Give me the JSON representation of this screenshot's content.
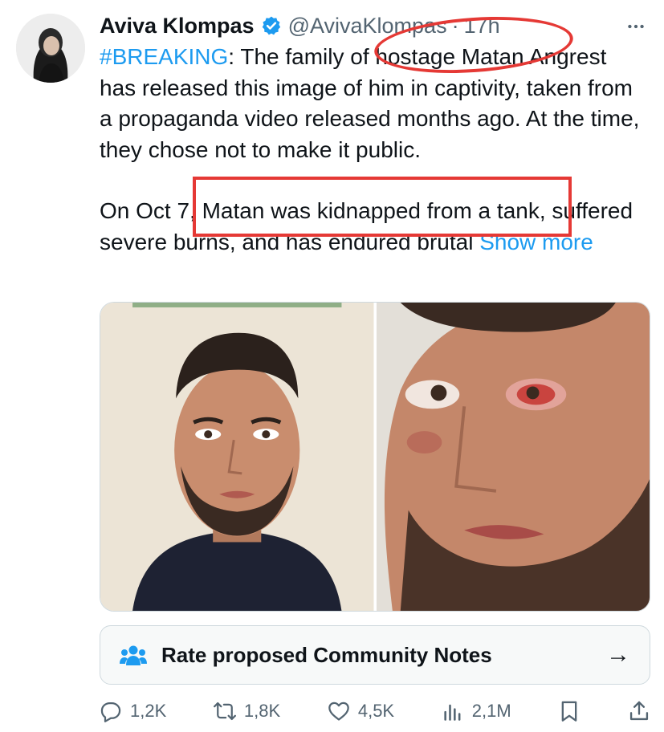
{
  "tweet": {
    "author_name": "Aviva Klompas",
    "handle": "@AvivaKlompas",
    "separator": "·",
    "time": "17h",
    "more_icon": "more-dots-icon",
    "hashtag": "#BREAKING",
    "paragraph1_rest": ": The family of hostage Matan Angrest has released this image of him in captivity, taken from a propaganda video released months ago. At the time, they chose not to make it public.",
    "paragraph2": "On Oct 7, Matan was kidnapped from a tank, suffered severe burns, and has endured brutal",
    "show_more": "Show more"
  },
  "annotations": {
    "color": "#e53935"
  },
  "community_notes": {
    "label": "Rate proposed Community Notes",
    "icon": "people-icon",
    "arrow": "→"
  },
  "actions": {
    "replies": "1,2K",
    "reposts": "1,8K",
    "likes": "4,5K",
    "views": "2,1M"
  },
  "colors": {
    "accent": "#1d9bf0",
    "text": "#0f1419",
    "muted": "#536471",
    "annotation": "#e53935"
  }
}
